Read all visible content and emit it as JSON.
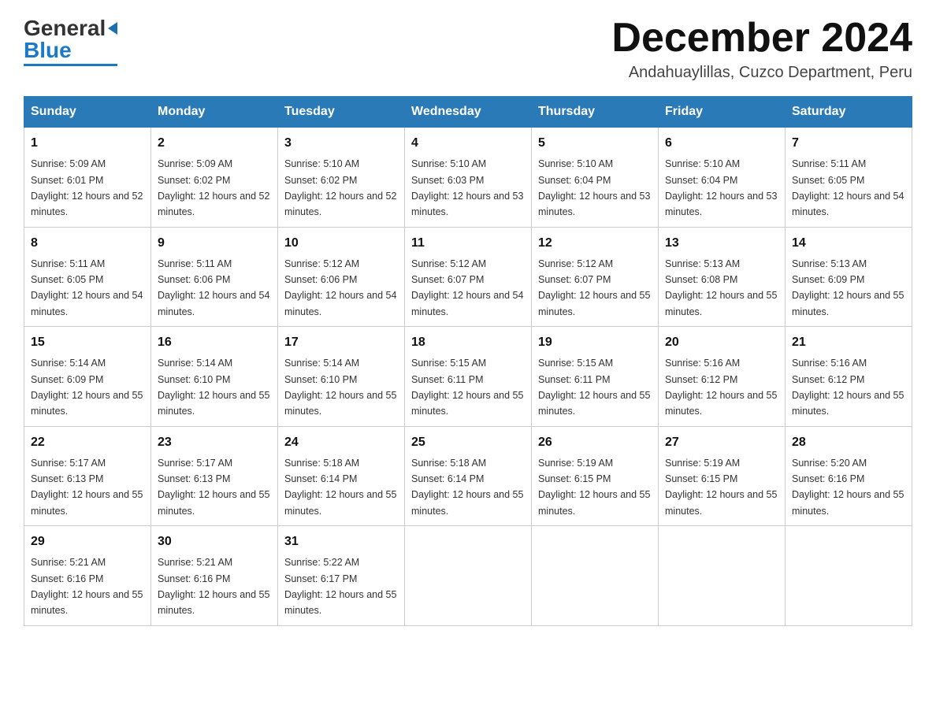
{
  "logo": {
    "line1": "General",
    "triangle": "▶",
    "line2": "Blue"
  },
  "title": "December 2024",
  "subtitle": "Andahuaylillas, Cuzco Department, Peru",
  "weekdays": [
    "Sunday",
    "Monday",
    "Tuesday",
    "Wednesday",
    "Thursday",
    "Friday",
    "Saturday"
  ],
  "weeks": [
    [
      {
        "day": "1",
        "sunrise": "5:09 AM",
        "sunset": "6:01 PM",
        "daylight": "12 hours and 52 minutes."
      },
      {
        "day": "2",
        "sunrise": "5:09 AM",
        "sunset": "6:02 PM",
        "daylight": "12 hours and 52 minutes."
      },
      {
        "day": "3",
        "sunrise": "5:10 AM",
        "sunset": "6:02 PM",
        "daylight": "12 hours and 52 minutes."
      },
      {
        "day": "4",
        "sunrise": "5:10 AM",
        "sunset": "6:03 PM",
        "daylight": "12 hours and 53 minutes."
      },
      {
        "day": "5",
        "sunrise": "5:10 AM",
        "sunset": "6:04 PM",
        "daylight": "12 hours and 53 minutes."
      },
      {
        "day": "6",
        "sunrise": "5:10 AM",
        "sunset": "6:04 PM",
        "daylight": "12 hours and 53 minutes."
      },
      {
        "day": "7",
        "sunrise": "5:11 AM",
        "sunset": "6:05 PM",
        "daylight": "12 hours and 54 minutes."
      }
    ],
    [
      {
        "day": "8",
        "sunrise": "5:11 AM",
        "sunset": "6:05 PM",
        "daylight": "12 hours and 54 minutes."
      },
      {
        "day": "9",
        "sunrise": "5:11 AM",
        "sunset": "6:06 PM",
        "daylight": "12 hours and 54 minutes."
      },
      {
        "day": "10",
        "sunrise": "5:12 AM",
        "sunset": "6:06 PM",
        "daylight": "12 hours and 54 minutes."
      },
      {
        "day": "11",
        "sunrise": "5:12 AM",
        "sunset": "6:07 PM",
        "daylight": "12 hours and 54 minutes."
      },
      {
        "day": "12",
        "sunrise": "5:12 AM",
        "sunset": "6:07 PM",
        "daylight": "12 hours and 55 minutes."
      },
      {
        "day": "13",
        "sunrise": "5:13 AM",
        "sunset": "6:08 PM",
        "daylight": "12 hours and 55 minutes."
      },
      {
        "day": "14",
        "sunrise": "5:13 AM",
        "sunset": "6:09 PM",
        "daylight": "12 hours and 55 minutes."
      }
    ],
    [
      {
        "day": "15",
        "sunrise": "5:14 AM",
        "sunset": "6:09 PM",
        "daylight": "12 hours and 55 minutes."
      },
      {
        "day": "16",
        "sunrise": "5:14 AM",
        "sunset": "6:10 PM",
        "daylight": "12 hours and 55 minutes."
      },
      {
        "day": "17",
        "sunrise": "5:14 AM",
        "sunset": "6:10 PM",
        "daylight": "12 hours and 55 minutes."
      },
      {
        "day": "18",
        "sunrise": "5:15 AM",
        "sunset": "6:11 PM",
        "daylight": "12 hours and 55 minutes."
      },
      {
        "day": "19",
        "sunrise": "5:15 AM",
        "sunset": "6:11 PM",
        "daylight": "12 hours and 55 minutes."
      },
      {
        "day": "20",
        "sunrise": "5:16 AM",
        "sunset": "6:12 PM",
        "daylight": "12 hours and 55 minutes."
      },
      {
        "day": "21",
        "sunrise": "5:16 AM",
        "sunset": "6:12 PM",
        "daylight": "12 hours and 55 minutes."
      }
    ],
    [
      {
        "day": "22",
        "sunrise": "5:17 AM",
        "sunset": "6:13 PM",
        "daylight": "12 hours and 55 minutes."
      },
      {
        "day": "23",
        "sunrise": "5:17 AM",
        "sunset": "6:13 PM",
        "daylight": "12 hours and 55 minutes."
      },
      {
        "day": "24",
        "sunrise": "5:18 AM",
        "sunset": "6:14 PM",
        "daylight": "12 hours and 55 minutes."
      },
      {
        "day": "25",
        "sunrise": "5:18 AM",
        "sunset": "6:14 PM",
        "daylight": "12 hours and 55 minutes."
      },
      {
        "day": "26",
        "sunrise": "5:19 AM",
        "sunset": "6:15 PM",
        "daylight": "12 hours and 55 minutes."
      },
      {
        "day": "27",
        "sunrise": "5:19 AM",
        "sunset": "6:15 PM",
        "daylight": "12 hours and 55 minutes."
      },
      {
        "day": "28",
        "sunrise": "5:20 AM",
        "sunset": "6:16 PM",
        "daylight": "12 hours and 55 minutes."
      }
    ],
    [
      {
        "day": "29",
        "sunrise": "5:21 AM",
        "sunset": "6:16 PM",
        "daylight": "12 hours and 55 minutes."
      },
      {
        "day": "30",
        "sunrise": "5:21 AM",
        "sunset": "6:16 PM",
        "daylight": "12 hours and 55 minutes."
      },
      {
        "day": "31",
        "sunrise": "5:22 AM",
        "sunset": "6:17 PM",
        "daylight": "12 hours and 55 minutes."
      },
      null,
      null,
      null,
      null
    ]
  ],
  "colors": {
    "header_bg": "#2a7ab8",
    "header_text": "#ffffff",
    "border": "#aaaaaa"
  }
}
